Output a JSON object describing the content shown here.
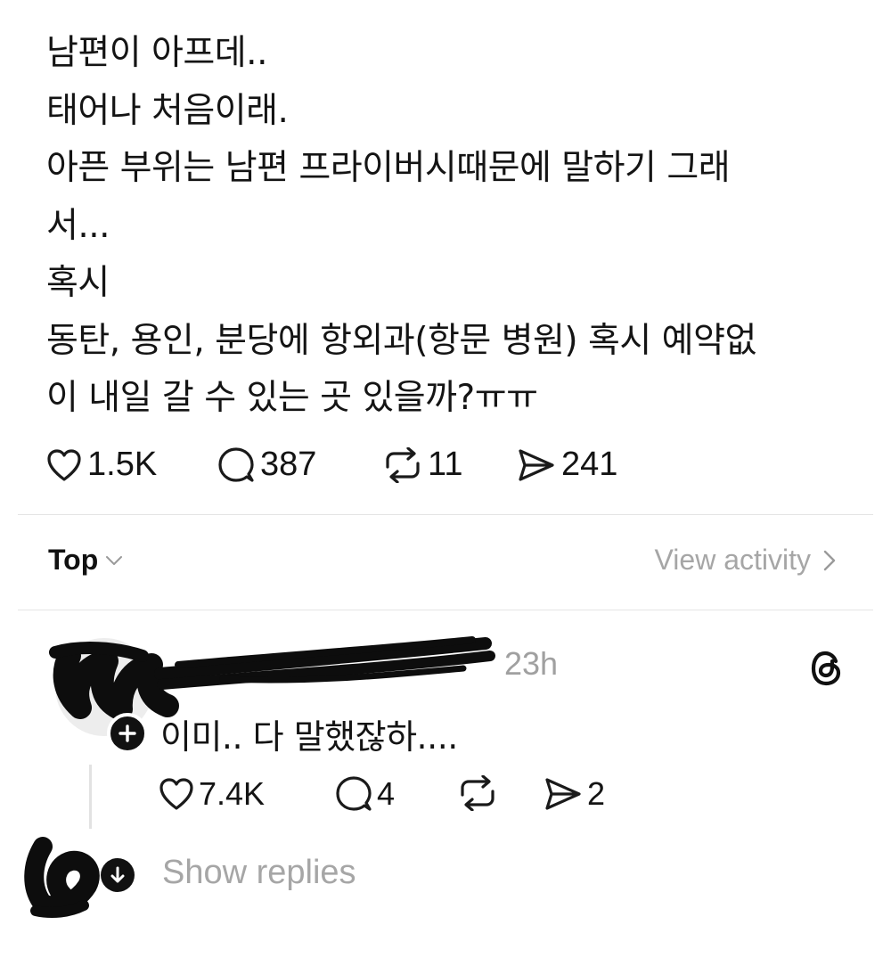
{
  "post": {
    "lines": [
      "남편이 아프데..",
      "태어나 처음이래.",
      "아픈 부위는 남편 프라이버시때문에 말하기 그래",
      "서...",
      "혹시",
      "동탄, 용인, 분당에 항외과(항문 병원) 혹시 예약없",
      "이 내일 갈 수 있는 곳 있을까?ㅠㅠ"
    ],
    "likes": "1.5K",
    "comments": "387",
    "reposts": "11",
    "shares": "241"
  },
  "sort": {
    "label": "Top"
  },
  "view_activity": {
    "label": "View activity"
  },
  "reply": {
    "timestamp": "23h",
    "text": "이미.. 다 말했잖하....",
    "likes": "7.4K",
    "comments": "4",
    "shares": "2",
    "show_replies": "Show replies"
  },
  "icons": {
    "like": "heart-icon",
    "comment": "comment-bubble-icon",
    "repost": "repost-icon",
    "share": "send-icon",
    "threads": "threads-logo-icon",
    "follow": "plus-icon",
    "expand": "arrow-down-icon"
  }
}
